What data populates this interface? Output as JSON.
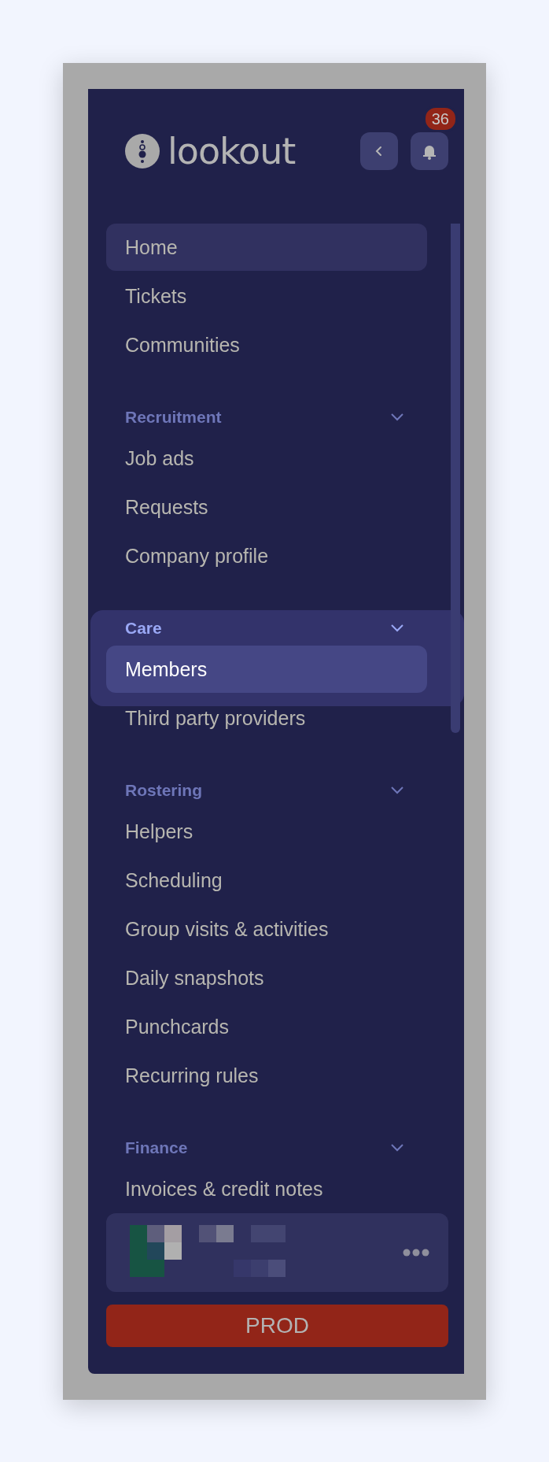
{
  "brand": {
    "name": "lookout"
  },
  "notifications": {
    "count": "36"
  },
  "nav": [
    {
      "kind": "group",
      "items": [
        {
          "label": "Home",
          "selected": false,
          "hovered": true
        },
        {
          "label": "Tickets",
          "selected": false,
          "hovered": false
        },
        {
          "label": "Communities",
          "selected": false,
          "hovered": false
        }
      ]
    },
    {
      "kind": "section",
      "title": "Recruitment",
      "expanded": true,
      "highlighted": false,
      "items": [
        {
          "label": "Job ads",
          "selected": false,
          "hovered": false
        },
        {
          "label": "Requests",
          "selected": false,
          "hovered": false
        },
        {
          "label": "Company profile",
          "selected": false,
          "hovered": false
        }
      ]
    },
    {
      "kind": "section",
      "title": "Care",
      "expanded": true,
      "highlighted": true,
      "items": [
        {
          "label": "Members",
          "selected": true,
          "hovered": false
        },
        {
          "label": "Third party providers",
          "selected": false,
          "hovered": false
        }
      ]
    },
    {
      "kind": "section",
      "title": "Rostering",
      "expanded": true,
      "highlighted": false,
      "items": [
        {
          "label": "Helpers",
          "selected": false,
          "hovered": false
        },
        {
          "label": "Scheduling",
          "selected": false,
          "hovered": false
        },
        {
          "label": "Group visits & activities",
          "selected": false,
          "hovered": false
        },
        {
          "label": "Daily snapshots",
          "selected": false,
          "hovered": false
        },
        {
          "label": "Punchcards",
          "selected": false,
          "hovered": false
        },
        {
          "label": "Recurring rules",
          "selected": false,
          "hovered": false
        }
      ]
    },
    {
      "kind": "section",
      "title": "Finance",
      "expanded": true,
      "highlighted": false,
      "items": [
        {
          "label": "Invoices & credit notes",
          "selected": false,
          "hovered": false
        }
      ]
    }
  ],
  "environment": {
    "label": "PROD"
  }
}
